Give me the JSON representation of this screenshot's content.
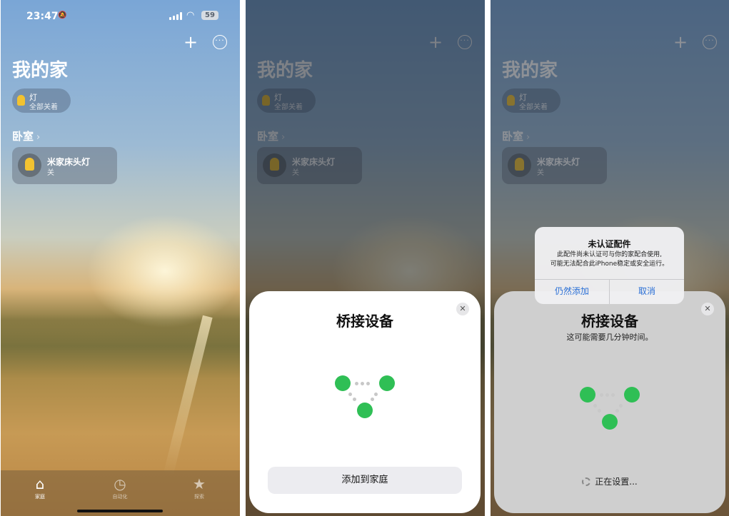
{
  "status": {
    "time": "23:47",
    "battery": "59"
  },
  "home": {
    "title": "我的家",
    "lights_chip": {
      "label": "灯",
      "status": "全部关着"
    },
    "room": {
      "name": "卧室",
      "chevron": "›"
    },
    "accessory": {
      "name": "米家床头灯",
      "state": "关"
    },
    "add_symbol": "+",
    "more_symbol": "···"
  },
  "tabs": [
    {
      "label": "家庭",
      "icon": "house-icon"
    },
    {
      "label": "自动化",
      "icon": "clock-icon"
    },
    {
      "label": "探索",
      "icon": "star-icon"
    }
  ],
  "bridge_sheet": {
    "title": "桥接设备",
    "add_button": "添加到家庭",
    "close_symbol": "✕"
  },
  "setup_sheet": {
    "title": "桥接设备",
    "subtitle": "这可能需要几分钟时间。",
    "progress": "正在设置..."
  },
  "alert": {
    "title": "未认证配件",
    "message_line1": "此配件尚未认证可与你的家配合使用,",
    "message_line2": "可能无法配合此iPhone稳定或安全运行。",
    "add_anyway": "仍然添加",
    "cancel": "取消"
  },
  "colors": {
    "accent_blue": "#2a6fd6",
    "node_green": "#2fbf55",
    "bulb_yellow": "#f2c230"
  }
}
